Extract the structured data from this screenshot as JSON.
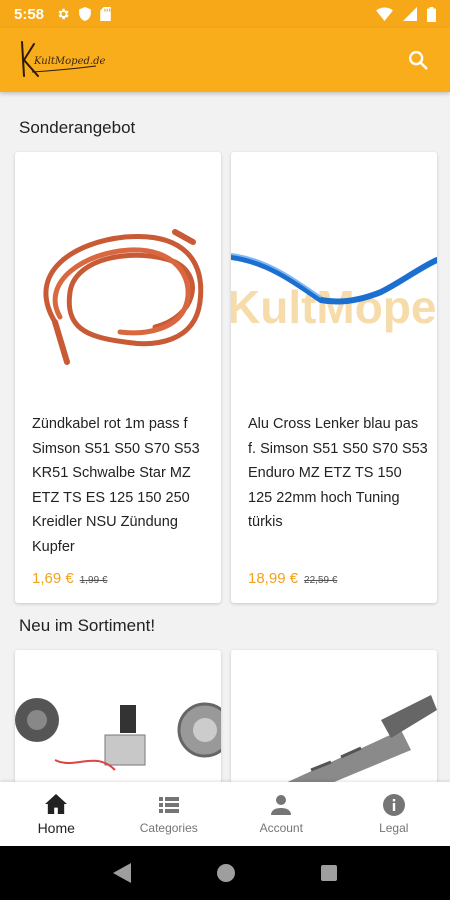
{
  "status_bar": {
    "time": "5:58"
  },
  "app_bar": {
    "logo_text": "KultMoped.de"
  },
  "sections": [
    {
      "title": "Sonderangebot",
      "products": [
        {
          "name": "Zündkabel rot 1m pass f Simson S51 S50 S70 S53 KR51 Schwalbe Star MZ ETZ TS ES 125 150 250 Kreidler NSU Zündung Kupfer",
          "price": "1,69 €",
          "old_price": "1,99 €"
        },
        {
          "name": "Alu Cross Lenker blau pas f. Simson S51 S50 S70 S53 Enduro MZ ETZ TS 150 125 22mm hoch Tuning türkis",
          "price": "18,99 €",
          "old_price": "22,59 €",
          "watermark": "KultMopeda"
        }
      ]
    },
    {
      "title": "Neu im Sortiment!"
    }
  ],
  "bottom_nav": [
    {
      "label": "Home",
      "icon": "home-icon",
      "active": true
    },
    {
      "label": "Categories",
      "icon": "list-icon",
      "active": false
    },
    {
      "label": "Account",
      "icon": "person-icon",
      "active": false
    },
    {
      "label": "Legal",
      "icon": "info-icon",
      "active": false
    }
  ],
  "colors": {
    "primary": "#f9ad1b",
    "status_bar": "#f6a818",
    "price": "#f2a21c"
  }
}
